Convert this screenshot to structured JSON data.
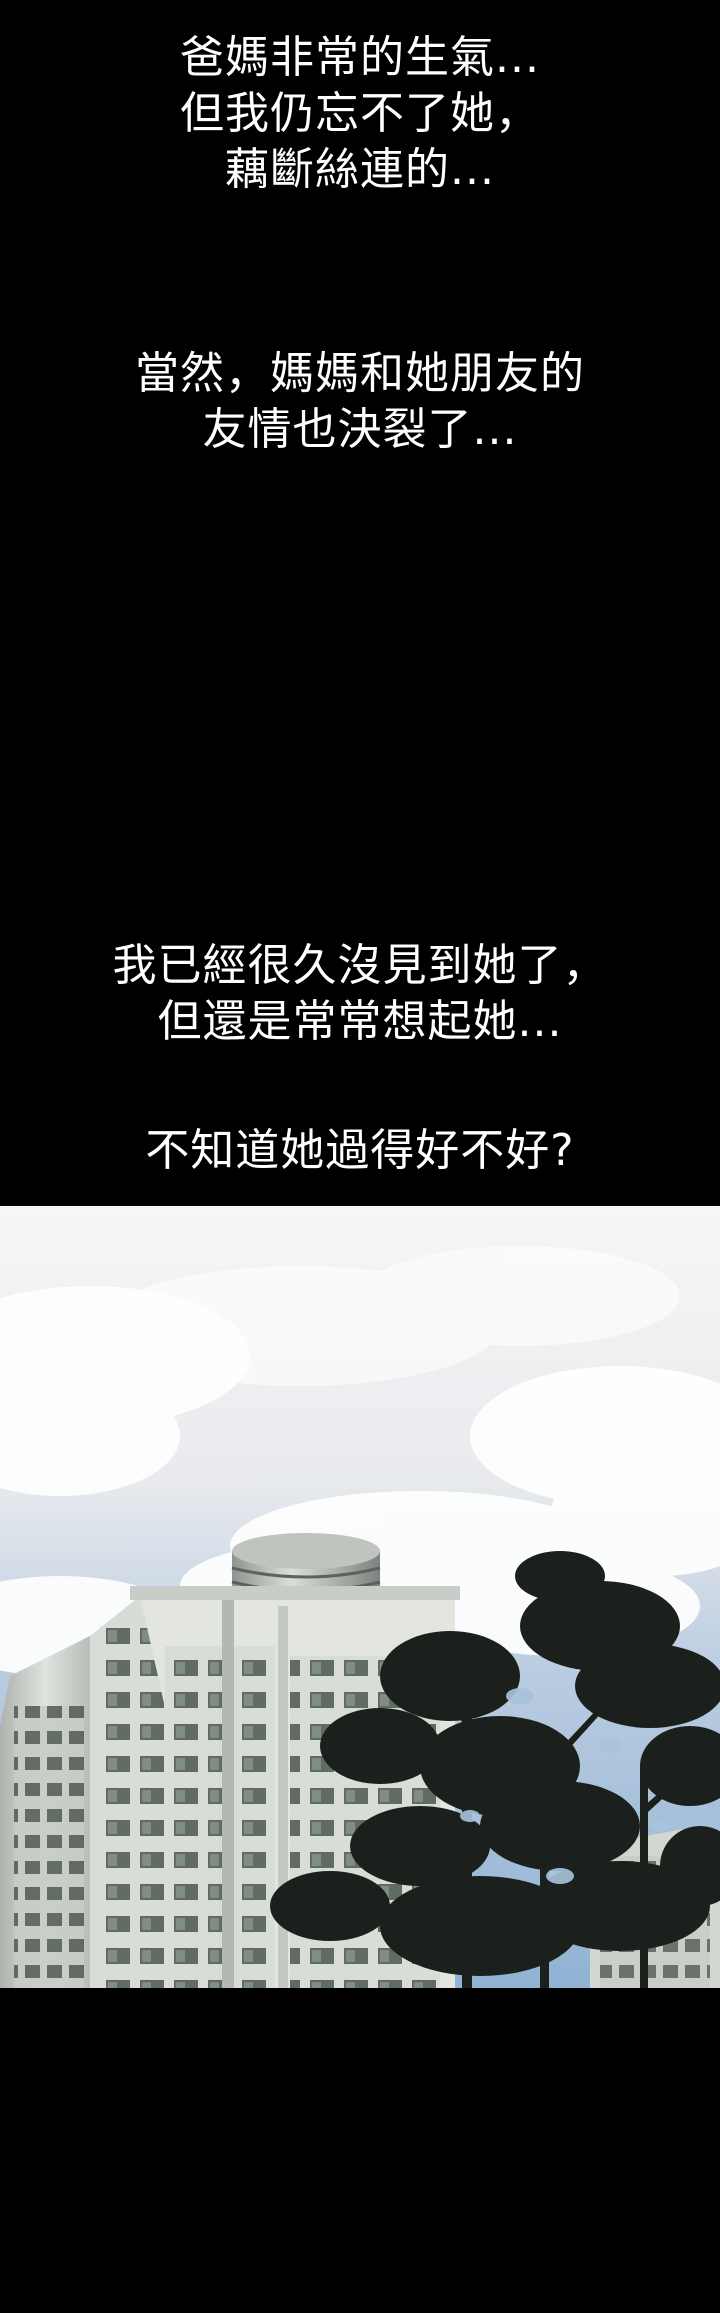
{
  "captions": [
    {
      "lines": [
        "爸媽非常的生氣...",
        "但我仍忘不了她，",
        "藕斷絲連的..."
      ]
    },
    {
      "lines": [
        "當然，媽媽和她朋友的",
        "友情也決裂了..."
      ]
    },
    {
      "lines": [
        "我已經很久沒見到她了，",
        "但還是常常想起她..."
      ]
    },
    {
      "lines": [
        "不知道她過得好不好?"
      ]
    }
  ],
  "panel": {
    "scene": "apartment-tower-under-cloudy-sky"
  },
  "colors": {
    "background": "#000000",
    "text": "#ffffff",
    "sky_top": "#f4f5f6",
    "sky_blue": "#9cbad6",
    "building": "#cfd3cf",
    "tree": "#1c201c"
  }
}
